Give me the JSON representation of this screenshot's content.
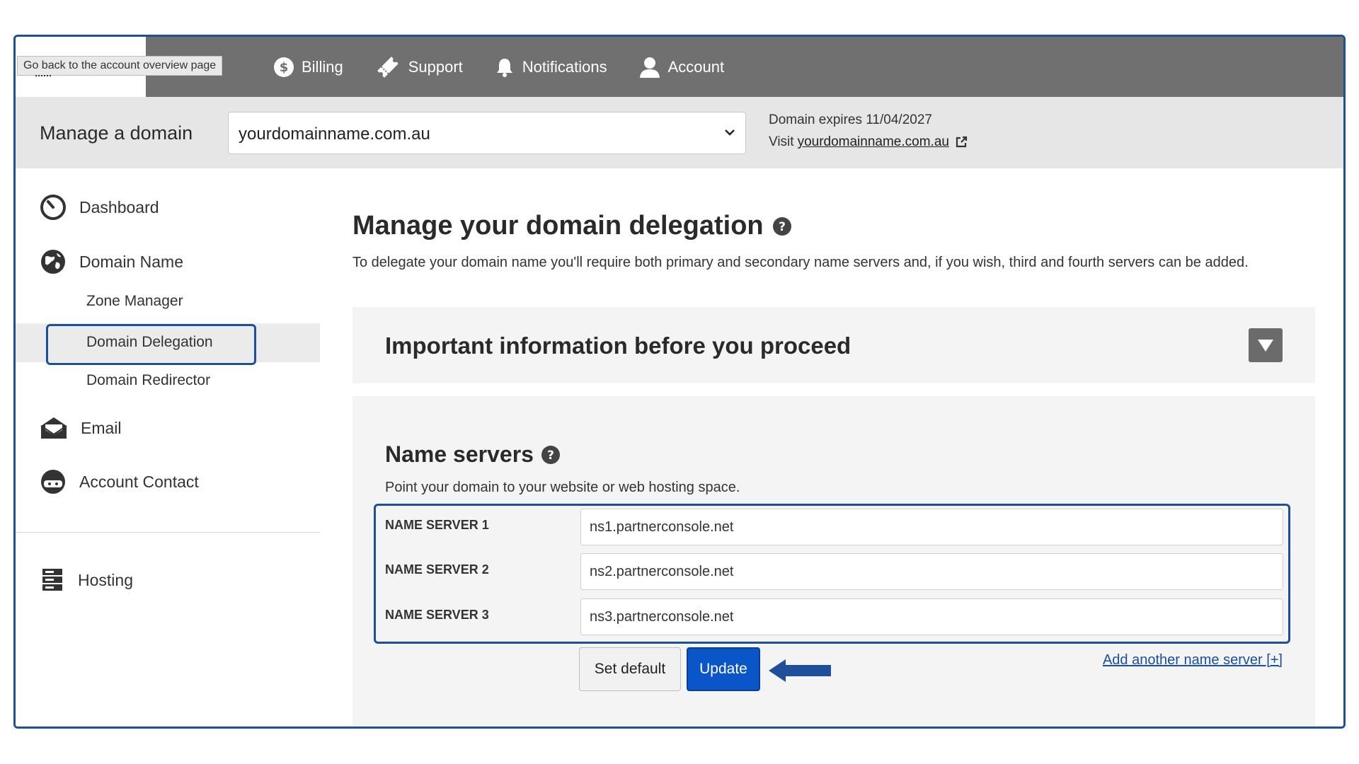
{
  "topbar": {
    "tooltip": "Go back to the account overview page",
    "nav": [
      {
        "label": "Billing",
        "icon": "dollar-circle-icon"
      },
      {
        "label": "Support",
        "icon": "ticket-icon"
      },
      {
        "label": "Notifications",
        "icon": "bell-icon"
      },
      {
        "label": "Account",
        "icon": "user-icon"
      }
    ]
  },
  "domainbar": {
    "label": "Manage a domain",
    "selected_domain": "yourdomainname.com.au",
    "expires": "Domain expires 11/04/2027",
    "visit_prefix": "Visit",
    "visit_link": "yourdomainname.com.au"
  },
  "sidebar": {
    "items": [
      {
        "label": "Dashboard",
        "icon": "dashboard-icon"
      },
      {
        "label": "Domain Name",
        "icon": "globe-icon"
      },
      {
        "label": "Email",
        "icon": "envelope-icon"
      },
      {
        "label": "Account Contact",
        "icon": "contact-icon"
      },
      {
        "label": "Hosting",
        "icon": "server-icon"
      }
    ],
    "sub_items": [
      "Zone Manager",
      "Domain Delegation",
      "Domain Redirector"
    ],
    "active_sub": "Domain Delegation"
  },
  "main": {
    "title": "Manage your domain delegation",
    "description": "To delegate your domain name you'll require both primary and secondary name servers and, if you wish, third and fourth servers can be added.",
    "info_title": "Important information before you proceed",
    "ns_title": "Name servers",
    "ns_subtitle": "Point your domain to your website or web hosting space.",
    "name_servers": [
      {
        "label": "NAME SERVER 1",
        "value": "ns1.partnerconsole.net"
      },
      {
        "label": "NAME SERVER 2",
        "value": "ns2.partnerconsole.net"
      },
      {
        "label": "NAME SERVER 3",
        "value": "ns3.partnerconsole.net"
      }
    ],
    "set_default_label": "Set default",
    "update_label": "Update",
    "add_link": "Add another name server [+]"
  },
  "colors": {
    "accent_blue": "#0a55c8",
    "outline_blue": "#1f4e9a",
    "topbar_gray": "#707070"
  }
}
